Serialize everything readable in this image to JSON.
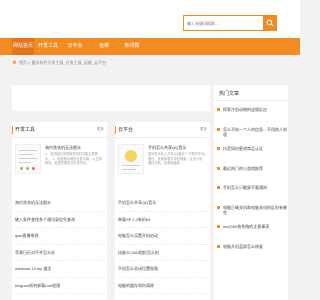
{
  "header": {
    "search_placeholder": "输入关键词搜索..."
  },
  "nav": {
    "items": [
      {
        "label": "网站首页",
        "active": true
      },
      {
        "label": "开发工具",
        "active": false
      },
      {
        "label": "云平台",
        "active": false
      },
      {
        "label": "运维",
        "active": false
      },
      {
        "label": "软讯猿",
        "active": false
      }
    ]
  },
  "breadcrumb": {
    "text": "首页 » 重庆软件开发工具_开发工具_运维_云平台"
  },
  "sections": [
    {
      "title": "开发工具",
      "more": "更多",
      "feature": {
        "title": "海尔洗衣机无法脱水",
        "desc": "1、洗衣服过多导致洗衣机不能正常脱水。 2、检查脱水槽是否放平稳，以正常转动，检查衣服是否分布均匀。"
      },
      "items": [
        "海尔洗衣机无法脱水",
        "输入条件查找多个通讯录信号查询",
        "ipad直播电视",
        "苹果日历对不齐怎么办",
        "windows 10 tsy 激活",
        "kingroot如何卸载root权限"
      ]
    },
    {
      "title": "云平台",
      "more": "更多",
      "feature": {
        "title": "手机怎么共享QQ音乐",
        "desc": "如何在手机上共享QQ音乐？只需打开QQ音乐，找到你想共享的歌曲，点击分享，通过手机，复制链接给..."
      },
      "items": [
        "手机怎么共享QQ音乐",
        "映泰SP 1.2有机64",
        "电脑怎么设置开机启动",
        "佳能20.30D相机怎么拍",
        "手机怎么关闭位置权限",
        "电脑的缓存如何清除"
      ]
    }
  ],
  "sidebar": {
    "title": "热门文章",
    "items": [
      "探索冷血动物的连锁反应",
      "怎么写给一个人的信息，不用他人知道",
      "抖音如何更改商品认证",
      "最近热门的小游戏推荐",
      "手机怎么只截屏不要通知",
      "电脑正确关机和电脑关机的区别有哪些",
      "ms2360装系统的注意事项",
      "电脑开机蓝屏怎么修复"
    ]
  },
  "colors": {
    "accent": "#f28c22",
    "nav_active": "#e2761a",
    "page_bg": "#f2f2f2"
  }
}
